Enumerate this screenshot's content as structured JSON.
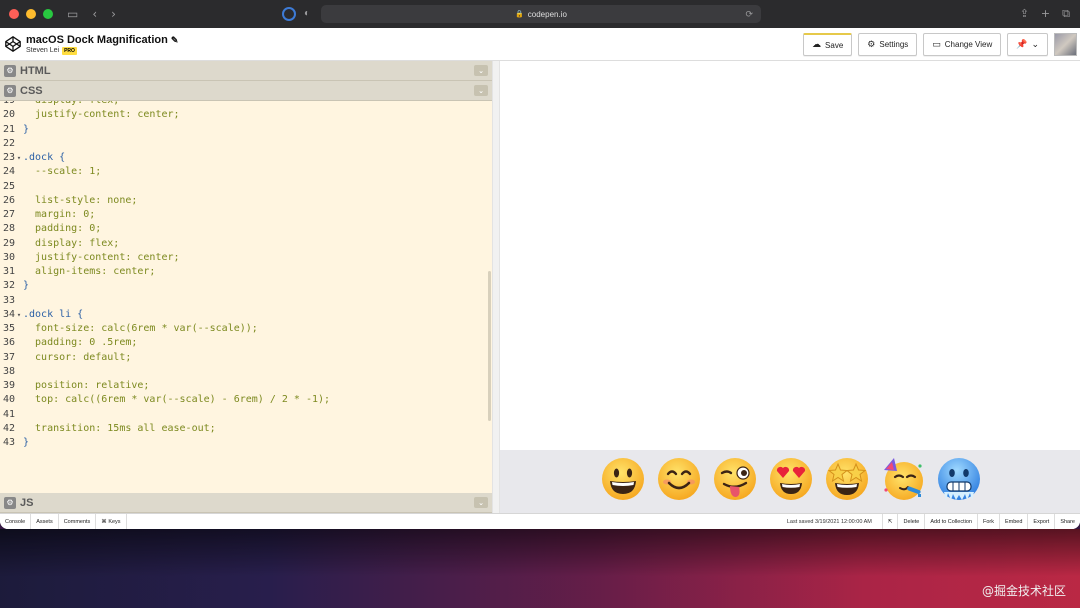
{
  "browser": {
    "url": "codepen.io",
    "icons": [
      "sidebar-icon",
      "back-icon",
      "forward-icon",
      "share-icon",
      "new-tab-icon",
      "tabs-overview-icon"
    ]
  },
  "header": {
    "pen_title": "macOS Dock Magnification",
    "author": "Steven Lei",
    "badge": "PRO",
    "save_label": "Save",
    "settings_label": "Settings",
    "change_view_label": "Change View"
  },
  "panels": {
    "html_label": "HTML",
    "css_label": "CSS",
    "js_label": "JS"
  },
  "code_lines": [
    {
      "n": "19",
      "fold": "",
      "text": "  display: flex;"
    },
    {
      "n": "20",
      "fold": "",
      "text": "  justify-content: center;"
    },
    {
      "n": "21",
      "fold": "",
      "text": "}"
    },
    {
      "n": "22",
      "fold": "",
      "text": ""
    },
    {
      "n": "23",
      "fold": "▾",
      "text": ".dock {"
    },
    {
      "n": "24",
      "fold": "",
      "text": "  --scale: 1;"
    },
    {
      "n": "25",
      "fold": "",
      "text": ""
    },
    {
      "n": "26",
      "fold": "",
      "text": "  list-style: none;"
    },
    {
      "n": "27",
      "fold": "",
      "text": "  margin: 0;"
    },
    {
      "n": "28",
      "fold": "",
      "text": "  padding: 0;"
    },
    {
      "n": "29",
      "fold": "",
      "text": "  display: flex;"
    },
    {
      "n": "30",
      "fold": "",
      "text": "  justify-content: center;"
    },
    {
      "n": "31",
      "fold": "",
      "text": "  align-items: center;"
    },
    {
      "n": "32",
      "fold": "",
      "text": "}"
    },
    {
      "n": "33",
      "fold": "",
      "text": ""
    },
    {
      "n": "34",
      "fold": "▾",
      "text": ".dock li {"
    },
    {
      "n": "35",
      "fold": "",
      "text": "  font-size: calc(6rem * var(--scale));"
    },
    {
      "n": "36",
      "fold": "",
      "text": "  padding: 0 .5rem;"
    },
    {
      "n": "37",
      "fold": "",
      "text": "  cursor: default;"
    },
    {
      "n": "38",
      "fold": "",
      "text": ""
    },
    {
      "n": "39",
      "fold": "",
      "text": "  position: relative;"
    },
    {
      "n": "40",
      "fold": "",
      "text": "  top: calc((6rem * var(--scale) - 6rem) / 2 * -1);"
    },
    {
      "n": "41",
      "fold": "",
      "text": ""
    },
    {
      "n": "42",
      "fold": "",
      "text": "  transition: 15ms all ease-out;"
    },
    {
      "n": "43",
      "fold": "",
      "text": "}"
    }
  ],
  "dock_emojis": [
    "grinning-face",
    "smiling-face",
    "winking-tongue-face",
    "heart-eyes-face",
    "star-struck-face",
    "partying-face",
    "cold-face"
  ],
  "footer": {
    "console": "Console",
    "assets": "Assets",
    "comments": "Comments",
    "keys": "⌘ Keys",
    "last_saved": "Last saved 3/19/2021 12:00:00 AM",
    "delete": "Delete",
    "add_to_collection": "Add to Collection",
    "fork": "Fork",
    "embed": "Embed",
    "export": "Export",
    "share": "Share"
  },
  "watermark": "@掘金技术社区",
  "colors": {
    "editor_bg": "#fff5e0",
    "panel_header": "#ddd9cc",
    "code_keyword": "#7d8a20",
    "code_selector": "#2a5fa5"
  }
}
